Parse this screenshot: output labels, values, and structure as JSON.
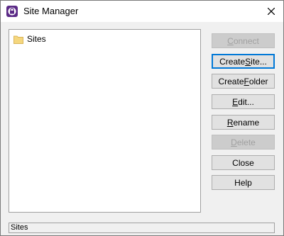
{
  "window": {
    "title": "Site Manager",
    "icon": "app-lock-icon",
    "close_icon": "close-icon"
  },
  "tree": {
    "items": [
      {
        "label": "Sites",
        "icon": "folder-icon"
      }
    ]
  },
  "buttons": {
    "connect": {
      "pre": "",
      "u": "C",
      "post": "onnect",
      "enabled": false
    },
    "create_site": {
      "pre": "Create ",
      "u": "S",
      "post": "ite...",
      "enabled": true,
      "default": true
    },
    "create_folder": {
      "pre": "Create ",
      "u": "F",
      "post": "older",
      "enabled": true
    },
    "edit": {
      "pre": "",
      "u": "E",
      "post": "dit...",
      "enabled": true
    },
    "rename": {
      "pre": "",
      "u": "R",
      "post": "ename",
      "enabled": true
    },
    "delete": {
      "pre": "",
      "u": "D",
      "post": "elete",
      "enabled": false
    },
    "close": {
      "pre": "Close",
      "u": "",
      "post": "",
      "enabled": true
    },
    "help": {
      "pre": "Help",
      "u": "",
      "post": "",
      "enabled": true
    }
  },
  "statusbar": {
    "text": "Sites"
  },
  "colors": {
    "folder": "#f5d77e",
    "icon_purple": "#5b2a86",
    "accent": "#0078d7"
  }
}
